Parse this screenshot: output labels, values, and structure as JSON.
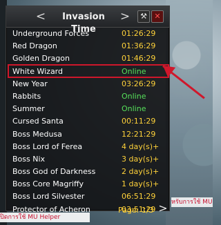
{
  "window": {
    "title": "Invasion Time",
    "prev_icon": "chevron-left-icon",
    "next_icon": "chevron-right-icon",
    "tools_icon": "wrench-icon",
    "close_icon": "close-icon",
    "prev_glyph": "<",
    "next_glyph": ">",
    "tools_glyph": "⚒",
    "close_glyph": "✕"
  },
  "invasions": [
    {
      "name": "Underground Forces",
      "value": "01:26:29",
      "status": "time"
    },
    {
      "name": "Red Dragon",
      "value": "01:36:29",
      "status": "time"
    },
    {
      "name": "Golden Dragon",
      "value": "01:46:29",
      "status": "time"
    },
    {
      "name": "White Wizard",
      "value": "Online",
      "status": "online"
    },
    {
      "name": "New Year",
      "value": "03:26:29",
      "status": "time"
    },
    {
      "name": "Rabbits",
      "value": "Online",
      "status": "online"
    },
    {
      "name": "Summer",
      "value": "Online",
      "status": "online"
    },
    {
      "name": "Cursed Santa",
      "value": "00:11:29",
      "status": "time"
    },
    {
      "name": "Boss Medusa",
      "value": "12:21:29",
      "status": "time"
    },
    {
      "name": "Boss Lord of Ferea",
      "value": "4 day(s)+",
      "status": "time"
    },
    {
      "name": "Boss Nix",
      "value": "3 day(s)+",
      "status": "time"
    },
    {
      "name": "Boss God of Darkness",
      "value": "2 day(s)+",
      "status": "time"
    },
    {
      "name": "Boss Core Magriffy",
      "value": "1 day(s)+",
      "status": "time"
    },
    {
      "name": "Boss Lord Silvester",
      "value": "06:51:29",
      "status": "time"
    },
    {
      "name": "Protector of Acheron",
      "value": "03:51:29",
      "status": "time"
    }
  ],
  "footer": {
    "page_label": "Page: 1/3",
    "next_glyph": ">"
  },
  "overlay_text": {
    "right": "หรับการใช้ MU",
    "bottom": "ปิดการใช้ MU Helper"
  },
  "colors": {
    "time": "#ffd23a",
    "online": "#56e05a",
    "highlight": "#d0172b"
  }
}
